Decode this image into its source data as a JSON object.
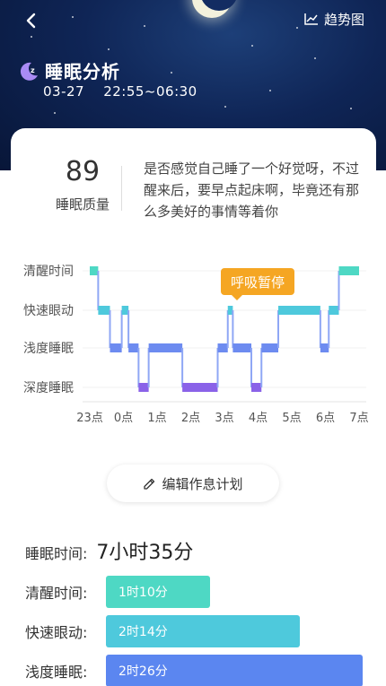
{
  "header": {
    "back_icon": "back-arrow-icon",
    "trend_label": "趋势图",
    "trend_icon": "trend-chart-icon",
    "title": "睡眠分析",
    "title_icon": "moon-zz-icon",
    "date": "03-27",
    "time_range": "22:55~06:30"
  },
  "score": {
    "value": "89",
    "label": "睡眠质量",
    "description": "是否感觉自己睡了一个好觉呀，不过醒来后，要早点起床啊，毕竟还有那么多美好的事情等着你"
  },
  "chart_data": {
    "type": "line",
    "stage_labels": [
      "清醒时间",
      "快速眼动",
      "浅度睡眠",
      "深度睡眠"
    ],
    "x_tick_labels": [
      "23点",
      "0点",
      "1点",
      "2点",
      "3点",
      "4点",
      "5点",
      "6点",
      "7点"
    ],
    "x_range_hours": [
      23,
      31
    ],
    "series": [
      {
        "type": "sleep-stage-steps",
        "segments": [
          {
            "start": 23.0,
            "end": 23.25,
            "stage": 0
          },
          {
            "start": 23.25,
            "end": 23.6,
            "stage": 1
          },
          {
            "start": 23.6,
            "end": 23.95,
            "stage": 2
          },
          {
            "start": 23.95,
            "end": 24.15,
            "stage": 1
          },
          {
            "start": 24.15,
            "end": 24.45,
            "stage": 2
          },
          {
            "start": 24.45,
            "end": 24.75,
            "stage": 3
          },
          {
            "start": 24.75,
            "end": 25.75,
            "stage": 2
          },
          {
            "start": 25.75,
            "end": 26.8,
            "stage": 3
          },
          {
            "start": 26.8,
            "end": 27.1,
            "stage": 2
          },
          {
            "start": 27.1,
            "end": 27.25,
            "stage": 1
          },
          {
            "start": 27.25,
            "end": 27.8,
            "stage": 2
          },
          {
            "start": 27.8,
            "end": 28.1,
            "stage": 3
          },
          {
            "start": 28.1,
            "end": 28.6,
            "stage": 2
          },
          {
            "start": 28.6,
            "end": 29.85,
            "stage": 1
          },
          {
            "start": 29.85,
            "end": 30.1,
            "stage": 2
          },
          {
            "start": 30.1,
            "end": 30.4,
            "stage": 1
          },
          {
            "start": 30.4,
            "end": 31.0,
            "stage": 0
          }
        ]
      }
    ],
    "stage_colors": [
      "#4ed8c4",
      "#4ec9dc",
      "#6d8bf0",
      "#8a62e8"
    ],
    "grid": true,
    "annotation": {
      "label": "呼吸暂停",
      "hour": 27.2,
      "color": "#f5a623"
    }
  },
  "edit_button": {
    "label": "编辑作息计划",
    "icon": "edit-pen-icon"
  },
  "summary": {
    "total_label": "睡眠时间:",
    "total_value": "7小时35分",
    "stages": [
      {
        "label": "清醒时间:",
        "value": "1时10分",
        "fraction": 0.28,
        "color": "#4ed8c4"
      },
      {
        "label": "快速眼动:",
        "value": "2时14分",
        "fraction": 0.52,
        "color": "#4ec9dc"
      },
      {
        "label": "浅度睡眠:",
        "value": "2时26分",
        "fraction": 0.69,
        "color": "#5b86f0"
      }
    ]
  }
}
